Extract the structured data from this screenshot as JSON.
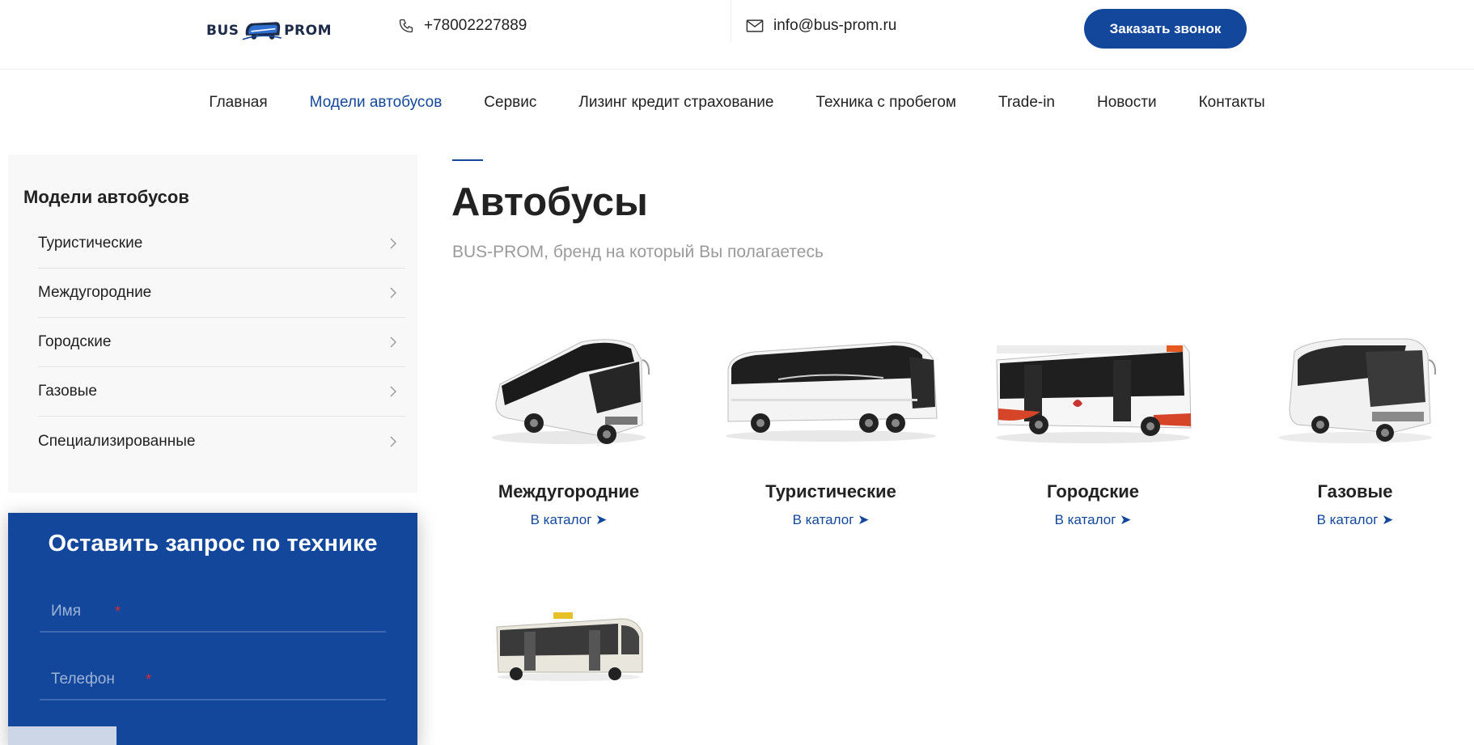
{
  "header": {
    "logo_left": "BUS",
    "logo_right": "PROM",
    "phone": "+78002227889",
    "email": "info@bus-prom.ru",
    "call_button": "Заказать звонок"
  },
  "nav": {
    "items": [
      {
        "label": "Главная",
        "active": false
      },
      {
        "label": "Модели автобусов",
        "active": true
      },
      {
        "label": "Сервис",
        "active": false
      },
      {
        "label": "Лизинг кредит страхование",
        "active": false
      },
      {
        "label": "Техника с пробегом",
        "active": false
      },
      {
        "label": "Trade-in",
        "active": false
      },
      {
        "label": "Новости",
        "active": false
      },
      {
        "label": "Контакты",
        "active": false
      }
    ]
  },
  "sidebar": {
    "title": "Модели автобусов",
    "items": [
      {
        "label": "Туристические"
      },
      {
        "label": "Междугородние"
      },
      {
        "label": "Городские"
      },
      {
        "label": "Газовые"
      },
      {
        "label": "Специализированные"
      }
    ]
  },
  "form": {
    "title": "Оставить запрос по технике",
    "name_placeholder": "Имя",
    "phone_placeholder": "Телефон",
    "required_mark": "*"
  },
  "main": {
    "title": "Автобусы",
    "subtitle": "BUS-PROM, бренд на который Вы полагаетесь",
    "link_label": "В каталог ➤",
    "cards": [
      {
        "name": "Междугородние"
      },
      {
        "name": "Туристические"
      },
      {
        "name": "Городские"
      },
      {
        "name": "Газовые"
      },
      {
        "name": ""
      }
    ]
  },
  "colors": {
    "accent": "#12479b",
    "text": "#222222",
    "muted": "#9a9a9a",
    "sidebar_bg": "#f8f8f8"
  }
}
